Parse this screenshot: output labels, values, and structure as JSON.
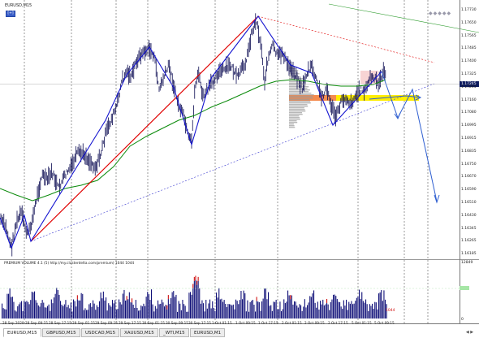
{
  "chart": {
    "symbol_title": "EURUSD,M15",
    "button_label": "[+]",
    "current_price": "1.17245",
    "price_labels": [
      "1.17730",
      "1.17650",
      "1.17565",
      "1.17485",
      "1.17400",
      "1.17325",
      "1.17245",
      "1.17160",
      "1.17080",
      "1.16995",
      "1.16915",
      "1.16835",
      "1.16750",
      "1.16670",
      "1.16590",
      "1.16510",
      "1.16430",
      "1.16345",
      "1.16265",
      "1.16185"
    ],
    "time_labels": [
      "28 Sep 2020",
      "28 Sep 09:15",
      "28 Sep 17:15",
      "29 Sep 01:15",
      "29 Sep 09:15",
      "29 Sep 17:15",
      "30 Sep 01:15",
      "30 Sep 09:15",
      "30 Sep 17:15",
      "1 Oct 01:15",
      "1 Oct 09:15",
      "1 Oct 17:15",
      "2 Oct 01:15",
      "2 Oct 09:15",
      "2 Oct 17:15",
      "5 Oct 01:15",
      "5 Oct 09:15"
    ],
    "colors": {
      "candles": "#0a0a52",
      "ma": "#0a8a0a",
      "zigzag": "#1414d0",
      "trend_red": "#e00000",
      "target": "#2f5fd0",
      "volume": "#101078",
      "volume_spike": "#d01010",
      "highlight_yellow": "#ffee00",
      "highlight_pink": "#f06a6a"
    }
  },
  "indicator": {
    "title": "PREMIUM VOLUME 4.1 (5) http://my.clusterdelta.com/premium) 1044 1044",
    "scale_max": "12849",
    "scale_min": "0",
    "last_value": "1044"
  },
  "tabs": [
    {
      "label": "EURUSD,M15",
      "active": true
    },
    {
      "label": "GBPUSD,M15",
      "active": false
    },
    {
      "label": "USDCAD,M15",
      "active": false
    },
    {
      "label": "XAUUSD,M15",
      "active": false
    },
    {
      "label": "_WTI,M15",
      "active": false
    },
    {
      "label": "EURUSD,M1",
      "active": false
    }
  ]
}
